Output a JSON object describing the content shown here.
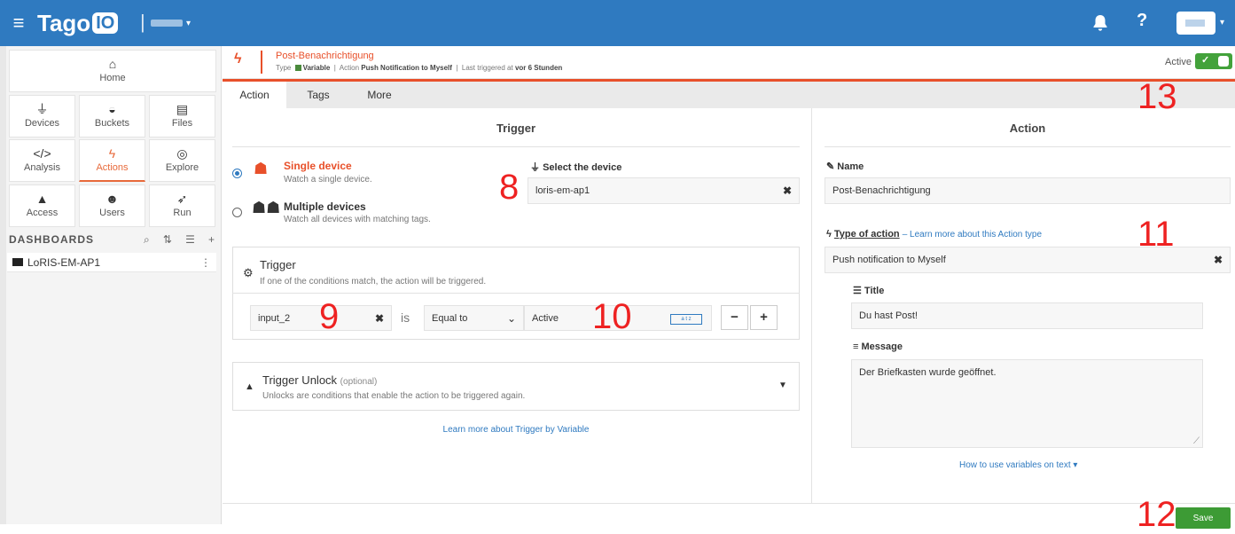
{
  "topbar": {
    "brand": "Tago",
    "brand_badge": "IO",
    "help": "?"
  },
  "sidebar": {
    "home": "Home",
    "tiles": [
      "Devices",
      "Buckets",
      "Files",
      "Analysis",
      "Actions",
      "Explore",
      "Access",
      "Users",
      "Run"
    ],
    "dashboards_heading": "DASHBOARDS",
    "dashboards": [
      {
        "name": "LoRIS-EM-AP1"
      }
    ]
  },
  "action_header": {
    "title": "Post-Benachrichtigung",
    "type_label": "Type",
    "type_value": "Variable",
    "action_label": "Action",
    "action_value": "Push Notification to Myself",
    "last_triggered_label": "Last triggered at",
    "last_triggered_value": "vor 6 Stunden",
    "active_label": "Active",
    "active_check": "✓"
  },
  "tabs": [
    "Action",
    "Tags",
    "More"
  ],
  "annotations": [
    "8",
    "9",
    "10",
    "11",
    "12",
    "13"
  ],
  "trigger_column": {
    "title": "Trigger",
    "single_device": {
      "title": "Single device",
      "subtitle": "Watch a single device.",
      "selected": true
    },
    "multiple_devices": {
      "title": "Multiple devices",
      "subtitle": "Watch all devices with matching tags.",
      "selected": false
    },
    "select_device_label": "Select the device",
    "device_value": "loris-em-ap1",
    "trigger_panel": {
      "title": "Trigger",
      "subtitle": "If one of the conditions match, the action will be triggered.",
      "variable": "input_2",
      "is_word": "is",
      "operator": "Equal to",
      "value": "Active",
      "value_type_badge": "a t z",
      "minus": "−",
      "plus": "+"
    },
    "unlock_panel": {
      "title": "Trigger Unlock",
      "optional": "(optional)",
      "subtitle": "Unlocks are conditions that enable the action to be triggered again."
    },
    "learn_more": "Learn more about Trigger by Variable"
  },
  "action_column": {
    "title": "Action",
    "name_label": "Name",
    "name_value": "Post-Benachrichtigung",
    "type_label": "Type of action",
    "type_link": "– Learn more about this Action type",
    "type_value": "Push notification to Myself",
    "title_label": "Title",
    "title_value": "Du hast Post!",
    "message_label": "Message",
    "message_value": "Der Briefkasten wurde geöffnet.",
    "variables_link": "How to use variables on text ▾",
    "save": "Save"
  }
}
